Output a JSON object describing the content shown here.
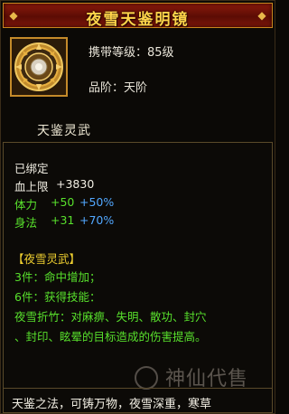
{
  "item": {
    "title": "夜雪天鉴明镜",
    "icon": "mirror-disc-icon",
    "requirement": "携带等级：85级",
    "grade": "品阶：天阶",
    "name": "天鉴灵武"
  },
  "status": {
    "bound": "已绑定",
    "stats": [
      {
        "label": "血上限",
        "base": "+3830",
        "bonus": ""
      },
      {
        "label": "体力",
        "base": "+50",
        "bonus": "+50%"
      },
      {
        "label": "身法",
        "base": "+31",
        "bonus": "+70%"
      }
    ]
  },
  "set": {
    "name": "【夜雪灵武】",
    "bonus3": "3件：命中增加；",
    "bonus6": "6件：获得技能：",
    "skill_line1": "夜雪折竹：对麻痹、失明、散功、封穴",
    "skill_line2": "、封印、眩晕的目标造成的伤害提高。"
  },
  "watermark": {
    "text": "神仙代售"
  },
  "description": "天鉴之法，可铸万物，夜雪深重，寒草",
  "colors": {
    "title": "#ffd44a",
    "stat_base": "#58e02c",
    "stat_bonus": "#52a8ff",
    "set_name": "#f0d030",
    "set_bonus": "#58e02c"
  }
}
